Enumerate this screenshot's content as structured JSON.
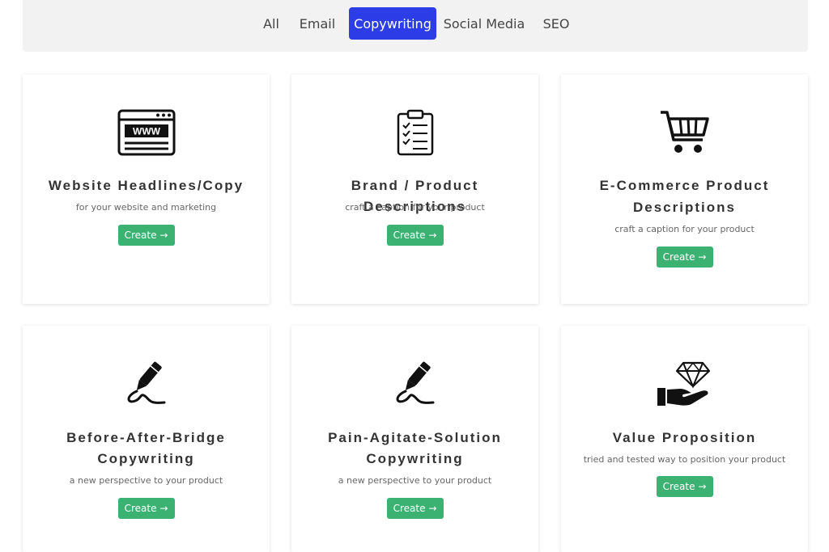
{
  "tabs": [
    {
      "label": "All"
    },
    {
      "label": "Email"
    },
    {
      "label": "Copywriting"
    },
    {
      "label": "Social Media"
    },
    {
      "label": "SEO"
    }
  ],
  "active_tab": "Copywriting",
  "colors": {
    "active_tab": "#2c3ce6",
    "create_button": "#3bb272"
  },
  "cards": [
    {
      "icon": "www-browser-icon",
      "title_lines": [
        "Website Headlines/Copy"
      ],
      "subtitle": "for your website and marketing",
      "button": "Create →"
    },
    {
      "icon": "clipboard-checklist-icon",
      "title_lines": [
        "Brand / Product Descriptions"
      ],
      "subtitle": "craft a caption for your product",
      "button": "Create →"
    },
    {
      "icon": "shopping-cart-icon",
      "title_lines": [
        "E-Commerce Product",
        "Descriptions"
      ],
      "subtitle": "craft a caption for your product",
      "button": "Create →"
    },
    {
      "icon": "pen-signature-icon",
      "title_lines": [
        "Before-After-Bridge",
        "Copywriting"
      ],
      "subtitle": "a new perspective to your product",
      "button": "Create →"
    },
    {
      "icon": "pen-signature-icon",
      "title_lines": [
        "Pain-Agitate-Solution",
        "Copywriting"
      ],
      "subtitle": "a new perspective to your product",
      "button": "Create →"
    },
    {
      "icon": "hand-diamond-icon",
      "title_lines": [
        "Value Proposition"
      ],
      "subtitle": "tried and tested way to position your product",
      "button": "Create →"
    }
  ]
}
